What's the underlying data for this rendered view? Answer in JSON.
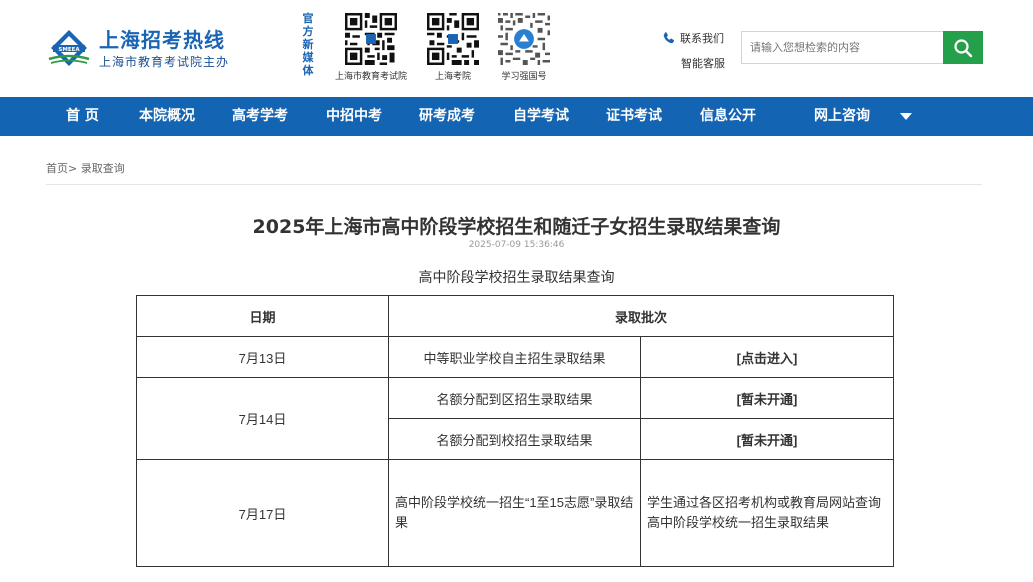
{
  "header": {
    "site_title": "上海招考热线",
    "site_subtitle": "上海市教育考试院主办",
    "emblem_text": "SMEEA",
    "media_label": [
      "官",
      "方",
      "新",
      "媒",
      "体"
    ],
    "qr_codes": [
      {
        "caption": "上海市教育考试院",
        "icon": "qr-code-icon"
      },
      {
        "caption": "上海考院",
        "icon": "qr-code-icon"
      },
      {
        "caption": "学习强国号",
        "icon": "qr-code-icon"
      }
    ],
    "contact_label": "联系我们",
    "service_label": "智能客服",
    "search_placeholder": "请输入您想检索的内容",
    "search_icon": "search-icon",
    "phone_icon": "phone-icon"
  },
  "nav": {
    "items": [
      "首 页",
      "本院概况",
      "高考学考",
      "中招中考",
      "研考成考",
      "自学考试",
      "证书考试",
      "信息公开",
      "网上咨询"
    ],
    "dropdown_icon": "caret-down-icon"
  },
  "breadcrumb": {
    "home": "首页",
    "separator": ">",
    "current": "录取查询"
  },
  "article": {
    "title": "2025年上海市高中阶段学校招生和随迁子女招生录取结果查询",
    "date": "2025-07-09 15:36:46",
    "table_caption": "高中阶段学校招生录取结果查询"
  },
  "table": {
    "headers": [
      "日期",
      "录取批次"
    ],
    "rows": [
      {
        "date": "7月13日",
        "batch": "中等职业学校自主招生录取结果",
        "action": "[点击进入]"
      },
      {
        "date": "7月14日",
        "batch": "名额分配到区招生录取结果",
        "action": "[暂未开通]"
      },
      {
        "date": "",
        "batch": "名额分配到校招生录取结果",
        "action": "[暂未开通]"
      },
      {
        "date": "7月17日",
        "batch": "高中阶段学校统一招生“1至15志愿”录取结果",
        "action": "学生通过各区招考机构或教育局网站查询高中阶段学校统一招生录取结果"
      }
    ]
  },
  "colors": {
    "brand_blue": "#1464b4",
    "search_green": "#24a04a"
  }
}
